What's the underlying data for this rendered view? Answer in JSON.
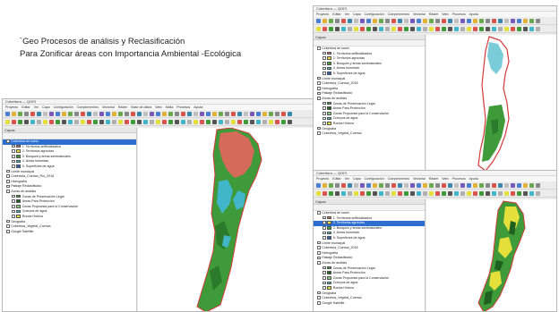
{
  "title": {
    "line1": "`Geo Procesos  de  análisis y Reclasificación",
    "line2": "Para Zonificar áreas con Importancia Ambiental -Ecológica"
  },
  "colors": {
    "forest": "#3f9a3a",
    "forest_dark": "#2c7a2b",
    "salmon": "#d66a5a",
    "cyan": "#41b6c9",
    "yellow": "#e4df3a",
    "outline": "#d43a3a",
    "selection": "#2c6fd1"
  },
  "window_left": {
    "titlebar": "Cobertura — QGIS",
    "menu": [
      "Proyecto",
      "Editar",
      "Ver",
      "Capa",
      "Configuración",
      "Complementos",
      "Vectorial",
      "Ráster",
      "Base de datos",
      "Web",
      "Malla",
      "Procesos",
      "Ayuda"
    ],
    "panel_title": "Capas",
    "layers": [
      {
        "label": "Cobertura de suelo",
        "swatch": "",
        "selected": true
      },
      {
        "label": "1. Territorios artificializados",
        "swatch": "#d66a5a"
      },
      {
        "label": "2. Territorios agrícolas",
        "swatch": "#e4df3a"
      },
      {
        "label": "3. Bosques y áreas seminaturales",
        "swatch": "#3f9a3a"
      },
      {
        "label": "4. Áreas húmedas",
        "swatch": "#41b6c9"
      },
      {
        "label": "5. Superficies de agua",
        "swatch": "#2c5fc4"
      },
      {
        "label": "Límite municipal",
        "swatch": ""
      },
      {
        "label": "Cobertura_Cuenca_Río_2018",
        "swatch": ""
      },
      {
        "label": "Hidrografía",
        "swatch": ""
      },
      {
        "label": "Paisaje Reclasificado",
        "swatch": ""
      },
      {
        "label": "Zonas de análisis",
        "swatch": ""
      },
      {
        "label": "Zonas de Preservación Legal",
        "swatch": "#3f9a3a"
      },
      {
        "label": "Áreas Para Protección",
        "swatch": "#1f5f1f"
      },
      {
        "label": "Zonas Propuesta para la Conservación",
        "swatch": "#8dd07a"
      },
      {
        "label": "Cuerpos de agua",
        "swatch": "#41b6c9"
      },
      {
        "label": "Ronda Hídrica",
        "swatch": "#e4df3a"
      },
      {
        "label": "Geografía",
        "swatch": ""
      },
      {
        "label": "Cobertura_Vegetal_Cuenca",
        "swatch": ""
      },
      {
        "label": "Google Satellite",
        "swatch": ""
      }
    ]
  },
  "window_top_right": {
    "titlebar": "Cobertura — QGIS",
    "menu": [
      "Proyecto",
      "Editar",
      "Ver",
      "Capa",
      "Configuración",
      "Complementos",
      "Vectorial",
      "Ráster",
      "Web",
      "Procesos",
      "Ayuda"
    ],
    "panel_title": "Capas",
    "layers": [
      {
        "label": "Cobertura de suelo",
        "swatch": ""
      },
      {
        "label": "1. Territorios artificializados",
        "swatch": "#d66a5a"
      },
      {
        "label": "2. Territorios agrícolas",
        "swatch": "#e4df3a"
      },
      {
        "label": "3. Bosques y áreas seminaturales",
        "swatch": "#3f9a3a"
      },
      {
        "label": "4. Áreas húmedas",
        "swatch": "#41b6c9"
      },
      {
        "label": "5. Superficies de agua",
        "swatch": "#2c5fc4"
      },
      {
        "label": "Límite municipal",
        "swatch": ""
      },
      {
        "label": "Cobertura_Cuenca_2018",
        "swatch": ""
      },
      {
        "label": "Hidrografía",
        "swatch": ""
      },
      {
        "label": "Paisaje Reclasificado",
        "swatch": ""
      },
      {
        "label": "Zonas de análisis",
        "swatch": ""
      },
      {
        "label": "Zonas de Preservación Legal",
        "swatch": "#3f9a3a"
      },
      {
        "label": "Áreas Para Protección",
        "swatch": "#1f5f1f"
      },
      {
        "label": "Zonas Propuesta para la Conservación",
        "swatch": "#8dd07a"
      },
      {
        "label": "Cuerpos de agua",
        "swatch": "#41b6c9"
      },
      {
        "label": "Ronda Hídrica",
        "swatch": "#e4df3a"
      },
      {
        "label": "Geografía",
        "swatch": ""
      },
      {
        "label": "Cobertura_Vegetal_Cuenca",
        "swatch": ""
      }
    ]
  },
  "window_bottom_right": {
    "titlebar": "Cobertura — QGIS",
    "menu": [
      "Proyecto",
      "Editar",
      "Ver",
      "Capa",
      "Configuración",
      "Complementos",
      "Vectorial",
      "Ráster",
      "Web",
      "Procesos",
      "Ayuda"
    ],
    "panel_title": "Capas",
    "layers": [
      {
        "label": "Cobertura de suelo",
        "swatch": ""
      },
      {
        "label": "1. Territorios artificializados",
        "swatch": "#d66a5a"
      },
      {
        "label": "2. Territorios agrícolas",
        "swatch": "#e4df3a",
        "selected": true
      },
      {
        "label": "3. Bosques y áreas seminaturales",
        "swatch": "#3f9a3a"
      },
      {
        "label": "4. Áreas húmedas",
        "swatch": "#41b6c9"
      },
      {
        "label": "5. Superficies de agua",
        "swatch": "#2c5fc4"
      },
      {
        "label": "Límite municipal",
        "swatch": ""
      },
      {
        "label": "Cobertura_Cuenca_2018",
        "swatch": ""
      },
      {
        "label": "Hidrografía",
        "swatch": ""
      },
      {
        "label": "Paisaje Reclasificado",
        "swatch": ""
      },
      {
        "label": "Zonas de análisis",
        "swatch": ""
      },
      {
        "label": "Zonas de Preservación Legal",
        "swatch": "#3f9a3a"
      },
      {
        "label": "Áreas Para Protección",
        "swatch": "#1f5f1f"
      },
      {
        "label": "Zonas Propuesta para la Conservación",
        "swatch": "#8dd07a"
      },
      {
        "label": "Cuerpos de agua",
        "swatch": "#41b6c9"
      },
      {
        "label": "Ronda Hídrica",
        "swatch": "#e4df3a"
      },
      {
        "label": "Geografía",
        "swatch": ""
      },
      {
        "label": "Cobertura_Vegetal_Cuenca",
        "swatch": ""
      },
      {
        "label": "Google Satellite",
        "swatch": ""
      }
    ]
  }
}
